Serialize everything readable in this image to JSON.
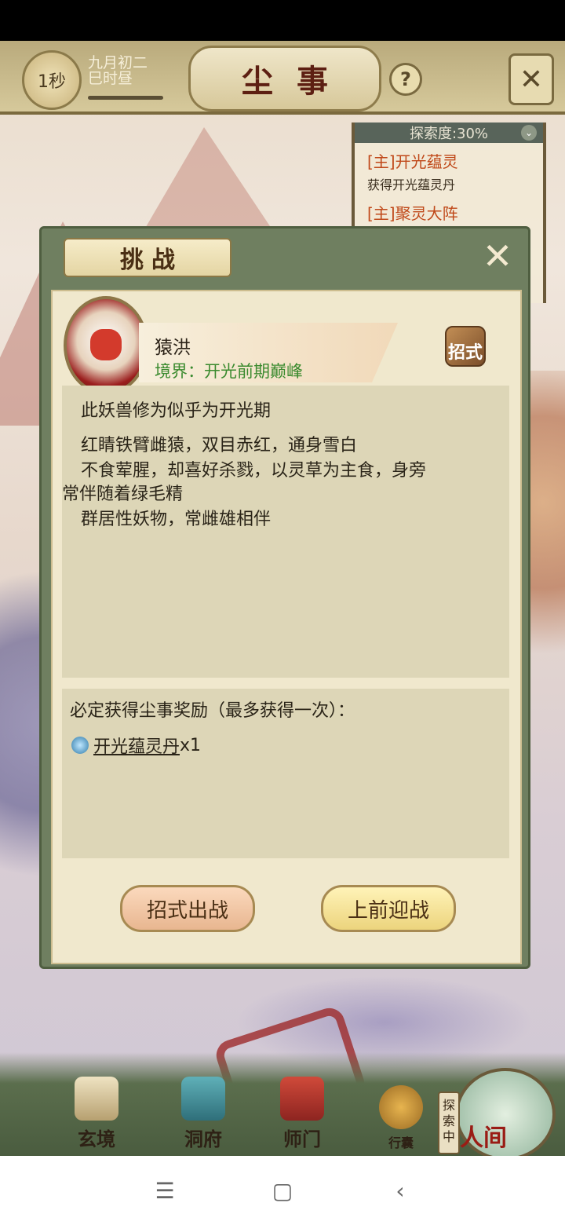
{
  "header": {
    "timer": "1秒",
    "date_line1": "九月初二",
    "date_line2": "巳时昼",
    "title": "尘事",
    "help": "?",
    "fullscreen_icon": "✕"
  },
  "quest_panel": {
    "explore_label": "探索度:30%",
    "toggle": "⌄",
    "items": [
      {
        "title": "[主]开光蕴灵",
        "desc": "获得开光蕴灵丹"
      },
      {
        "title": "[主]聚灵大阵"
      }
    ]
  },
  "modal": {
    "title": "挑战",
    "close": "✕",
    "monster_name": "猿洪",
    "monster_realm": "境界：开光前期巅峰",
    "skill_button": "招式",
    "description": [
      "此妖兽修为似乎为开光期",
      "红睛铁臂雌猿，双目赤红，通身雪白",
      "不食荤腥，却喜好杀戮，以灵草为主食，身旁",
      "常伴随着绿毛精",
      "群居性妖物，常雌雄相伴"
    ],
    "reward_heading": "必定获得尘事奖励（最多获得一次）：",
    "reward": {
      "name": "开光蕴灵丹",
      "count": "x1"
    },
    "buttons": {
      "skill_fight": "招式出战",
      "fight": "上前迎战"
    }
  },
  "bottom_nav": {
    "items": [
      "玄境",
      "洞府",
      "师门",
      "行囊"
    ],
    "explore_tag": "探索中",
    "world": "人间"
  },
  "system_nav": {
    "menu": "☰",
    "home": "▢",
    "back": "‹"
  },
  "colors": {
    "accent_green": "#3a8a2e",
    "quest_red": "#c0491a",
    "panel_bg": "#f0e8cd"
  }
}
